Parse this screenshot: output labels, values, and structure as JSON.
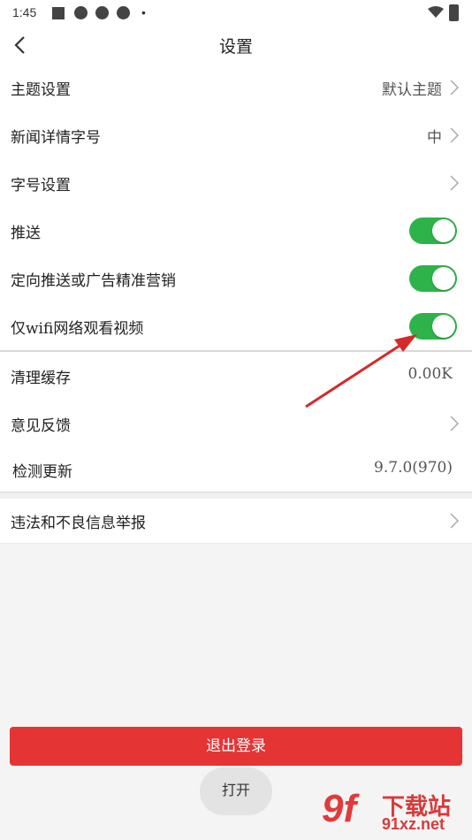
{
  "status_bar": {
    "time": "1:45",
    "dot": "•"
  },
  "header": {
    "title": "设置",
    "back_icon": "chevron-left-icon"
  },
  "rows": [
    {
      "label": "主题设置",
      "value": "默认主题",
      "type": "link"
    },
    {
      "label": "新闻详情字号",
      "value": "中",
      "type": "link"
    },
    {
      "label": "字号设置",
      "value": "",
      "type": "link"
    },
    {
      "label": "推送",
      "value": "on",
      "type": "toggle"
    },
    {
      "label": "定向推送或广告精准营销",
      "value": "on",
      "type": "toggle"
    },
    {
      "label": "仅wifi网络观看视频",
      "value": "on",
      "type": "toggle"
    },
    {
      "label": "清理缓存",
      "value": "0.00K",
      "type": "value"
    },
    {
      "label": "意见反馈",
      "value": "",
      "type": "link"
    },
    {
      "label": "检测更新",
      "value": "9.7.0(970)",
      "type": "value"
    },
    {
      "label": "违法和不良信息举报",
      "value": "",
      "type": "link"
    }
  ],
  "logout_label": "退出登录",
  "toast_label": "打开",
  "watermark": {
    "brand": "9f",
    "text1": "下载站",
    "text2": "91xz.net"
  },
  "colors": {
    "accent": "#e53434",
    "toggle_on": "#2db34a",
    "arrow": "#d42a2a"
  }
}
